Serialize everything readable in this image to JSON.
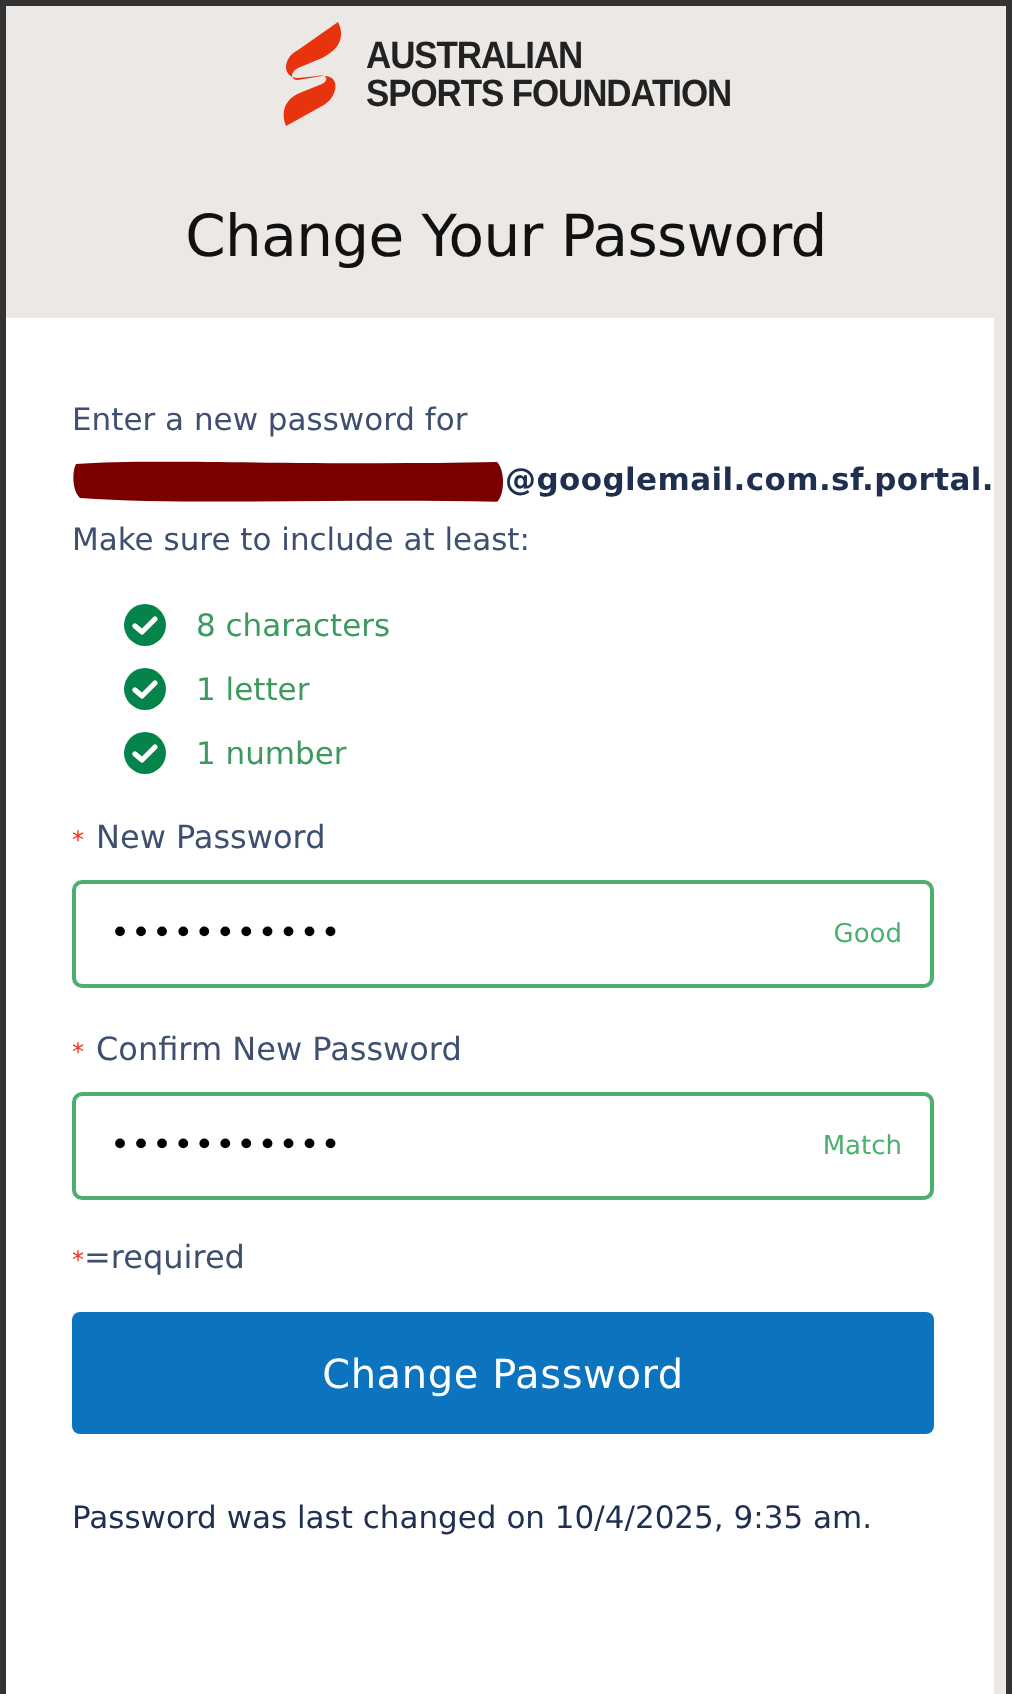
{
  "brand": {
    "line_1": "AUSTRALIAN",
    "line_2": "SPORTS FOUNDATION"
  },
  "title": "Change Your Password",
  "intro": "Enter a new password for",
  "email_visible_part": "@googlemail.com.sf.portal.",
  "requirements_heading": "Make sure to include at least:",
  "requirements": [
    {
      "label": "8 characters",
      "met": true
    },
    {
      "label": "1 letter",
      "met": true
    },
    {
      "label": "1 number",
      "met": true
    }
  ],
  "fields": [
    {
      "label": "New Password",
      "required_mark": "*",
      "value": "•••••••••••",
      "status": "Good",
      "valid": true
    },
    {
      "label": "Confirm New Password",
      "required_mark": "*",
      "value": "•••••••••••",
      "status": "Match",
      "valid": true
    }
  ],
  "required_legend": {
    "mark": "*",
    "text": "=required"
  },
  "submit_button": "Change Password",
  "last_changed": "Password was last changed on 10/4/2025, 9:35 am."
}
